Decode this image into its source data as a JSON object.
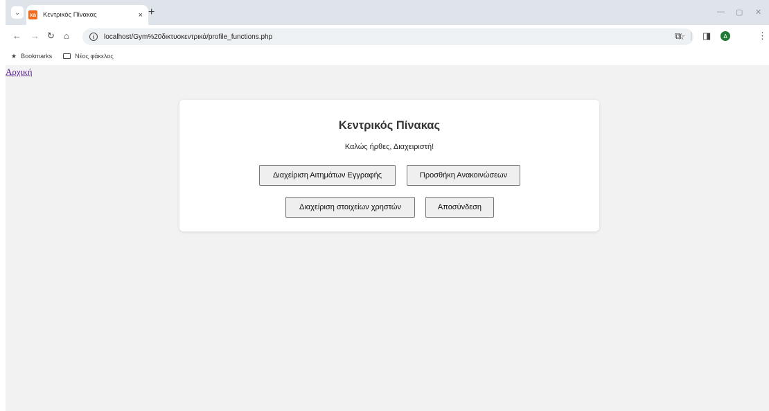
{
  "browser": {
    "tab_title": "Κεντρικός Πίνακας",
    "tab_close": "×",
    "new_tab": "+",
    "url": "localhost/Gym%20δικτυοκεντρικά/profile_functions.php",
    "avatar_letter": "Δ",
    "favicon_letter": "xa"
  },
  "bookmarks": {
    "items": [
      {
        "label": "Bookmarks",
        "icon": "star-icon"
      },
      {
        "label": "Νέος φάκελος",
        "icon": "folder-icon"
      }
    ]
  },
  "page": {
    "home_link": "Αρχική",
    "card_title": "Κεντρικός Πίνακας",
    "welcome": "Καλώς ήρθες, Διαχειριστή!",
    "buttons": {
      "manage_requests": "Διαχείριση Αιτημάτων Εγγραφής",
      "add_announcements": "Προσθήκη Ανακοινώσεων",
      "manage_users": "Διαχείριση στοιχείων χρηστών",
      "logout": "Αποσύνδεση"
    }
  }
}
